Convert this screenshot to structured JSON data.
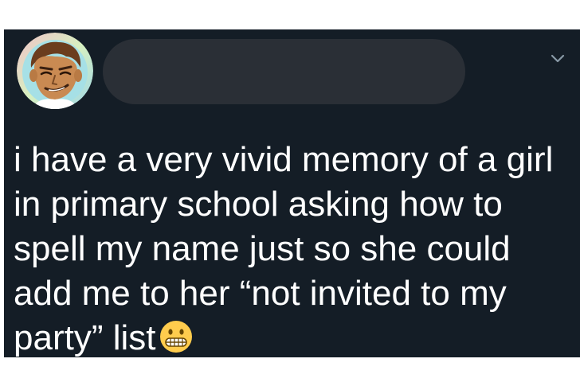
{
  "tweet": {
    "author_avatar_icon": "cartoon-face-avatar-icon",
    "menu_icon": "chevron-down-icon",
    "text_lines": [
      "i have a very vivid memory of a girl",
      "in primary school asking how to",
      "spell my name just so she could",
      "add me to her “not invited to my",
      "party” list"
    ],
    "emoji": "grimacing-face-emoji",
    "colors": {
      "background": "#141d26",
      "text": "#ffffff",
      "redaction": "#2a2f36",
      "chevron": "#8899a6"
    }
  }
}
